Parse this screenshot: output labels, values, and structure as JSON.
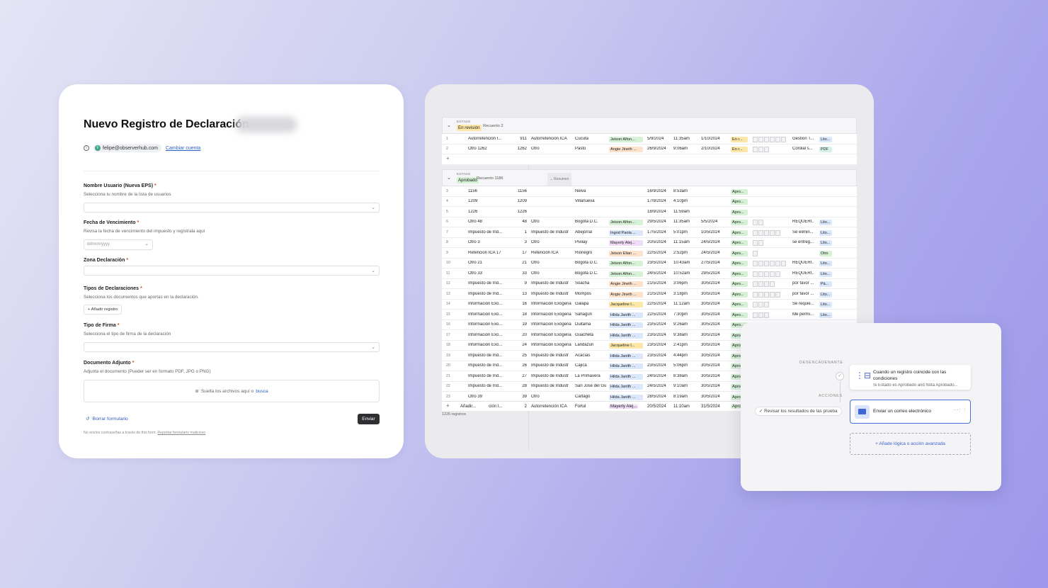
{
  "form": {
    "title": "Nuevo Registro de Declaración",
    "account": {
      "email": "felipe@observerhub.com",
      "avatar_letter": "F",
      "switch_label": "Cambiar cuenta"
    },
    "fields": [
      {
        "label": "Nombre Usuario (Nueva EPS)",
        "help": "Selecciona tu nombre de la lista de usuarios"
      },
      {
        "label": "Fecha de Vencimiento",
        "help": "Revisa la fecha de vencimiento del impuesto y regístrala aquí",
        "placeholder": "dd/mm/yyyy"
      },
      {
        "label": "Zona Declaración",
        "help": ""
      },
      {
        "label": "Tipos de Declaraciones",
        "help": "Selecciona los documentos que aportas en la declaración.",
        "button": "Añadir registro"
      },
      {
        "label": "Tipo de Firma",
        "help": "Selecciona el tipo de firma de la declaración"
      },
      {
        "label": "Documento Adjunto",
        "help": "Adjunta el documento (Pueder ser en formato PDF, JPG o PNG)",
        "drop_text": "Suelta los archivos aquí o",
        "drop_link": "busca"
      }
    ],
    "reset_label": "Borrar formulario",
    "submit_label": "Enviar",
    "disclaimer_text": "No envíes contraseñas a través de this form.",
    "disclaimer_link": "Reportar formulario malicioso"
  },
  "table": {
    "groups": [
      {
        "field": "ESTADO",
        "value": "En revisión",
        "count_label": "Recuento 2",
        "color": "#fde7a8"
      },
      {
        "field": "ESTADO",
        "value": "Aprobado",
        "count_label": "Recuento 1186",
        "color": "#d6f1d6",
        "summary_label": "Resumen"
      }
    ],
    "rows_review": [
      {
        "n": "1",
        "name": "Autorretención I...",
        "num": "911",
        "type": "Autorretención ICA",
        "city": "Cúcuta",
        "person": "Jeison Alfon...",
        "pcolor": "#d6f1d6",
        "d1": "5/9/2024",
        "t": "11:35am",
        "d2": "1/10/2024",
        "st": "En r...",
        "stcolor": "#fde7a8",
        "att": 6,
        "note": "Gestión T...",
        "tag": "Lito...",
        "tagcolor": "#dbe7fb"
      },
      {
        "n": "2",
        "name": "Otro 1262",
        "num": "1262",
        "type": "Otro",
        "city": "Pasto",
        "person": "Angie Jineth ...",
        "pcolor": "#fde2cc",
        "d1": "26/9/2024",
        "t": "9:06am",
        "d2": "2/10/2024",
        "st": "En r...",
        "stcolor": "#fde7a8",
        "att": 3,
        "note": "Cordial s...",
        "tag": "PDF",
        "tagcolor": "#d6f1ea"
      }
    ],
    "rows_approved": [
      {
        "n": "3",
        "name": "1156",
        "num": "1156",
        "type": "",
        "city": "Neiva",
        "person": "",
        "pcolor": "",
        "d1": "16/9/2024",
        "t": "8:53am",
        "d2": "",
        "st": "Apro...",
        "stcolor": "#d6f1d6",
        "att": 0,
        "note": "",
        "tag": "",
        "tagcolor": ""
      },
      {
        "n": "4",
        "name": "1209",
        "num": "1209",
        "type": "",
        "city": "Villanueva",
        "person": "",
        "pcolor": "",
        "d1": "17/9/2024",
        "t": "4:10pm",
        "d2": "",
        "st": "Apro...",
        "stcolor": "#d6f1d6",
        "att": 0,
        "note": "",
        "tag": "",
        "tagcolor": ""
      },
      {
        "n": "5",
        "name": "1226",
        "num": "1226",
        "type": "",
        "city": "",
        "person": "",
        "pcolor": "",
        "d1": "18/9/2024",
        "t": "11:59am",
        "d2": "",
        "st": "Apro...",
        "stcolor": "#d6f1d6",
        "att": 0,
        "note": "",
        "tag": "",
        "tagcolor": ""
      },
      {
        "n": "6",
        "name": "Otro 48",
        "num": "48",
        "type": "Otro",
        "city": "Bogotá D.C.",
        "person": "Jeison Alfon...",
        "pcolor": "#d6f1d6",
        "d1": "29/5/2024",
        "t": "11:35am",
        "d2": "5/5/2024",
        "st": "Apro...",
        "stcolor": "#d6f1d6",
        "att": 2,
        "note": "REQUERI...",
        "tag": "Lito...",
        "tagcolor": "#dbe7fb"
      },
      {
        "n": "7",
        "name": "Impuesto de Ind...",
        "num": "1",
        "type": "Impuesto de Industr",
        "city": "Abejorral",
        "person": "Ingrid Paola ...",
        "pcolor": "#dbe7fb",
        "d1": "17/5/2024",
        "t": "5:01pm",
        "d2": "10/5/2024",
        "st": "Apro...",
        "stcolor": "#d6f1d6",
        "att": 5,
        "note": "Se elimin...",
        "tag": "Lito...",
        "tagcolor": "#dbe7fb"
      },
      {
        "n": "8",
        "name": "Otro 3",
        "num": "3",
        "type": "Otro",
        "city": "Piviiay",
        "person": "Mayerly Alej...",
        "pcolor": "#f0dcf5",
        "d1": "20/5/2024",
        "t": "11:15am",
        "d2": "24/5/2024",
        "st": "Apro...",
        "stcolor": "#d6f1d6",
        "att": 2,
        "note": "se entreg...",
        "tag": "Lito...",
        "tagcolor": "#dbe7fb"
      },
      {
        "n": "9",
        "name": "Retencion ICA 17",
        "num": "17",
        "type": "Retencion ICA",
        "city": "Rionegro",
        "person": "Jeison Elian ...",
        "pcolor": "#fde2cc",
        "d1": "22/5/2024",
        "t": "2:52pm",
        "d2": "24/5/2024",
        "st": "Apro...",
        "stcolor": "#d6f1d6",
        "att": 1,
        "note": "",
        "tag": "Otro",
        "tagcolor": "#d6f1d6"
      },
      {
        "n": "10",
        "name": "Otro 21",
        "num": "21",
        "type": "Otro",
        "city": "Bogotá D.C.",
        "person": "Jeison Alfon...",
        "pcolor": "#d6f1d6",
        "d1": "23/5/2024",
        "t": "10:43am",
        "d2": "27/5/2024",
        "st": "Apro...",
        "stcolor": "#d6f1d6",
        "att": 6,
        "note": "REQUERI...",
        "tag": "Lito...",
        "tagcolor": "#dbe7fb"
      },
      {
        "n": "11",
        "name": "Otro 33",
        "num": "33",
        "type": "Otro",
        "city": "Bogotá D.C.",
        "person": "Jeison Alfon...",
        "pcolor": "#d6f1d6",
        "d1": "24/5/2024",
        "t": "10:52am",
        "d2": "29/5/2024",
        "st": "Apro...",
        "stcolor": "#d6f1d6",
        "att": 5,
        "note": "REQUERI...",
        "tag": "Lito...",
        "tagcolor": "#dbe7fb"
      },
      {
        "n": "12",
        "name": "Impuesto de Ind...",
        "num": "9",
        "type": "Impuesto de Industr",
        "city": "Soacha",
        "person": "Angie Jineth ...",
        "pcolor": "#fde2cc",
        "d1": "21/5/2024",
        "t": "3:06pm",
        "d2": "30/5/2024",
        "st": "Apro...",
        "stcolor": "#d6f1d6",
        "att": 4,
        "note": "por favor ...",
        "tag": "Pá...",
        "tagcolor": "#dbe7fb"
      },
      {
        "n": "13",
        "name": "Impuesto de Ind...",
        "num": "13",
        "type": "Impuesto de Industr",
        "city": "Mompós",
        "person": "Angie Jineth ...",
        "pcolor": "#fde2cc",
        "d1": "21/5/2024",
        "t": "3:18pm",
        "d2": "30/5/2024",
        "st": "Apro...",
        "stcolor": "#d6f1d6",
        "att": 5,
        "note": "por favor ...",
        "tag": "Lito...",
        "tagcolor": "#dbe7fb"
      },
      {
        "n": "14",
        "name": "Información Exó...",
        "num": "16",
        "type": "Información Exógena",
        "city": "Galapa",
        "person": "Jacqueline I...",
        "pcolor": "#fde7a8",
        "d1": "22/5/2024",
        "t": "11:12am",
        "d2": "30/5/2024",
        "st": "Apro...",
        "stcolor": "#d6f1d6",
        "att": 3,
        "note": "Se requie...",
        "tag": "Lito...",
        "tagcolor": "#dbe7fb"
      },
      {
        "n": "15",
        "name": "Información Exó...",
        "num": "18",
        "type": "Información Exógena",
        "city": "Sahagún",
        "person": "Hilda Janith ...",
        "pcolor": "#dbe7fb",
        "d1": "22/5/2024",
        "t": "7:30pm",
        "d2": "30/5/2024",
        "st": "Apro...",
        "stcolor": "#d6f1d6",
        "att": 3,
        "note": "Me permi...",
        "tag": "Lito...",
        "tagcolor": "#dbe7fb"
      },
      {
        "n": "16",
        "name": "Información Exó...",
        "num": "19",
        "type": "Información Exógena",
        "city": "Duitama",
        "person": "Hilda Janith ...",
        "pcolor": "#dbe7fb",
        "d1": "23/5/2024",
        "t": "9:26am",
        "d2": "30/5/2024",
        "st": "Apro...",
        "stcolor": "#d6f1d6",
        "att": 0,
        "note": "",
        "tag": "",
        "tagcolor": ""
      },
      {
        "n": "17",
        "name": "Información Exó...",
        "num": "20",
        "type": "Información Exógena",
        "city": "Guachetá",
        "person": "Hilda Janith ...",
        "pcolor": "#dbe7fb",
        "d1": "23/5/2024",
        "t": "9:38am",
        "d2": "30/5/2024",
        "st": "Apro",
        "stcolor": "#d6f1d6",
        "att": 0,
        "note": "",
        "tag": "",
        "tagcolor": ""
      },
      {
        "n": "18",
        "name": "Información Exó...",
        "num": "24",
        "type": "Información Exógena",
        "city": "Landázuri",
        "person": "Jacqueline I...",
        "pcolor": "#fde7a8",
        "d1": "23/5/2024",
        "t": "2:41pm",
        "d2": "30/5/2024",
        "st": "Apro",
        "stcolor": "#d6f1d6",
        "att": 0,
        "note": "",
        "tag": "",
        "tagcolor": ""
      },
      {
        "n": "19",
        "name": "Impuesto de Ind...",
        "num": "25",
        "type": "Impuesto de Industr",
        "city": "Acacías",
        "person": "Hilda Janith ...",
        "pcolor": "#dbe7fb",
        "d1": "23/5/2024",
        "t": "4:44pm",
        "d2": "30/5/2024",
        "st": "Apro",
        "stcolor": "#d6f1d6",
        "att": 0,
        "note": "",
        "tag": "",
        "tagcolor": ""
      },
      {
        "n": "20",
        "name": "Impuesto de Ind...",
        "num": "26",
        "type": "Impuesto de Industr",
        "city": "Cajicá",
        "person": "Hilda Janith ...",
        "pcolor": "#dbe7fb",
        "d1": "23/5/2024",
        "t": "5:06pm",
        "d2": "30/5/2024",
        "st": "Apro",
        "stcolor": "#d6f1d6",
        "att": 0,
        "note": "",
        "tag": "",
        "tagcolor": ""
      },
      {
        "n": "21",
        "name": "Impuesto de Ind...",
        "num": "27",
        "type": "Impuesto de Industr",
        "city": "La Primavera",
        "person": "Hilda Janith ...",
        "pcolor": "#dbe7fb",
        "d1": "24/5/2024",
        "t": "8:38am",
        "d2": "30/5/2024",
        "st": "Apro",
        "stcolor": "#d6f1d6",
        "att": 0,
        "note": "",
        "tag": "",
        "tagcolor": ""
      },
      {
        "n": "22",
        "name": "Impuesto de Ind...",
        "num": "28",
        "type": "Impuesto de Industr",
        "city": "San José del Gu",
        "person": "Hilda Janith ...",
        "pcolor": "#dbe7fb",
        "d1": "24/5/2024",
        "t": "9:10am",
        "d2": "30/5/2024",
        "st": "Apro",
        "stcolor": "#d6f1d6",
        "att": 0,
        "note": "",
        "tag": "",
        "tagcolor": ""
      },
      {
        "n": "23",
        "name": "Otro 39",
        "num": "39",
        "type": "Otro",
        "city": "Cartago",
        "person": "Hilda Janith ...",
        "pcolor": "#dbe7fb",
        "d1": "28/5/2024",
        "t": "8:19am",
        "d2": "30/5/2024",
        "st": "Apro",
        "stcolor": "#d6f1d6",
        "att": 0,
        "note": "",
        "tag": "",
        "tagcolor": ""
      }
    ],
    "bottom_row": {
      "add_label": "Añadir...",
      "name": "ción I...",
      "num": "2",
      "type": "Autorretención ICA",
      "city": "Fortul",
      "person": "Mayerly Alej...",
      "d1": "20/5/2024",
      "t": "11:10am",
      "d2": "31/5/2024",
      "st": "Apro"
    },
    "footer": "1226 registros"
  },
  "automation": {
    "trigger_section": "DESENCADENANTE",
    "actions_section": "ACCIONES",
    "trigger_title": "Cuando un registro coincide con las condiciones",
    "trigger_subtitle": "Si Estado es Aprobado and Nota Aprobado...",
    "test_label": "Revisar los resultados de las prueba",
    "email_action": "Enviar un correo electrónico",
    "advanced_label": "Añade lógica o acción avanzada",
    "accent": "#4a6fdc"
  }
}
